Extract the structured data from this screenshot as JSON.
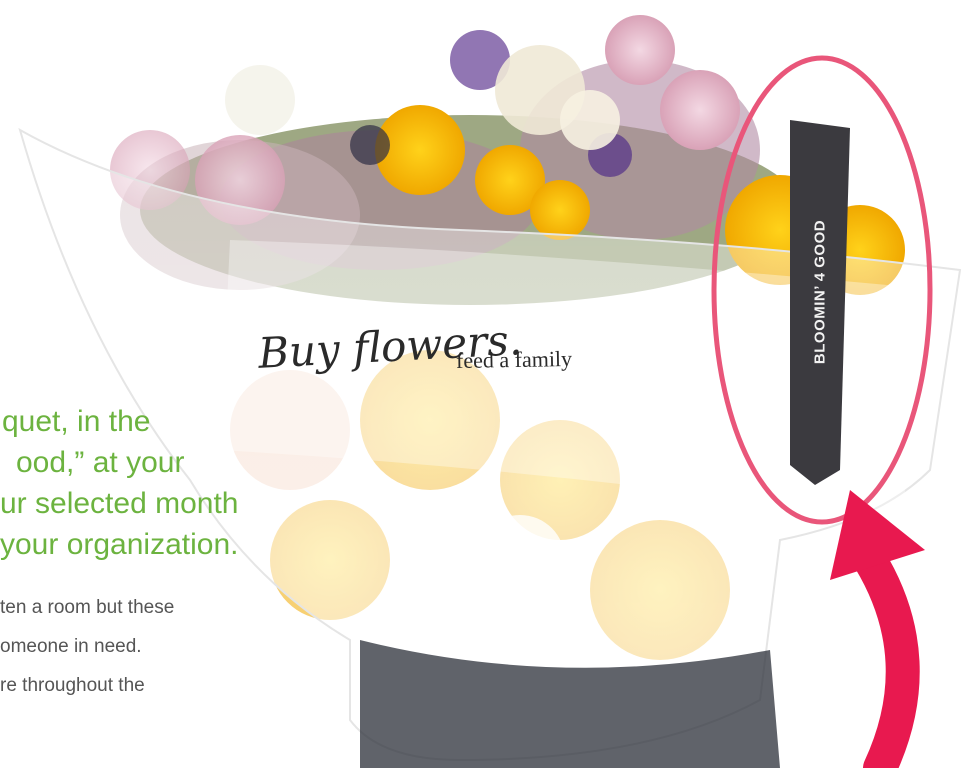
{
  "overlay_text": {
    "green_lines": [
      "quet, in the",
      "ood,” at your",
      "ur selected month",
      "your organization."
    ],
    "gray_lines": [
      "ten a room but these",
      "omeone in need.",
      "re throughout the"
    ]
  },
  "sleeve": {
    "script_text": "Buy flowers.",
    "plain_text": "feed a family",
    "ribbon_text": "BLOOMIN’ 4 GOOD"
  },
  "colors": {
    "highlight_ellipse": "#e9567a",
    "arrow": "#e8194f",
    "ribbon": "#3b3a3f",
    "heading_green": "#6cb33f",
    "body_gray": "#555555"
  }
}
